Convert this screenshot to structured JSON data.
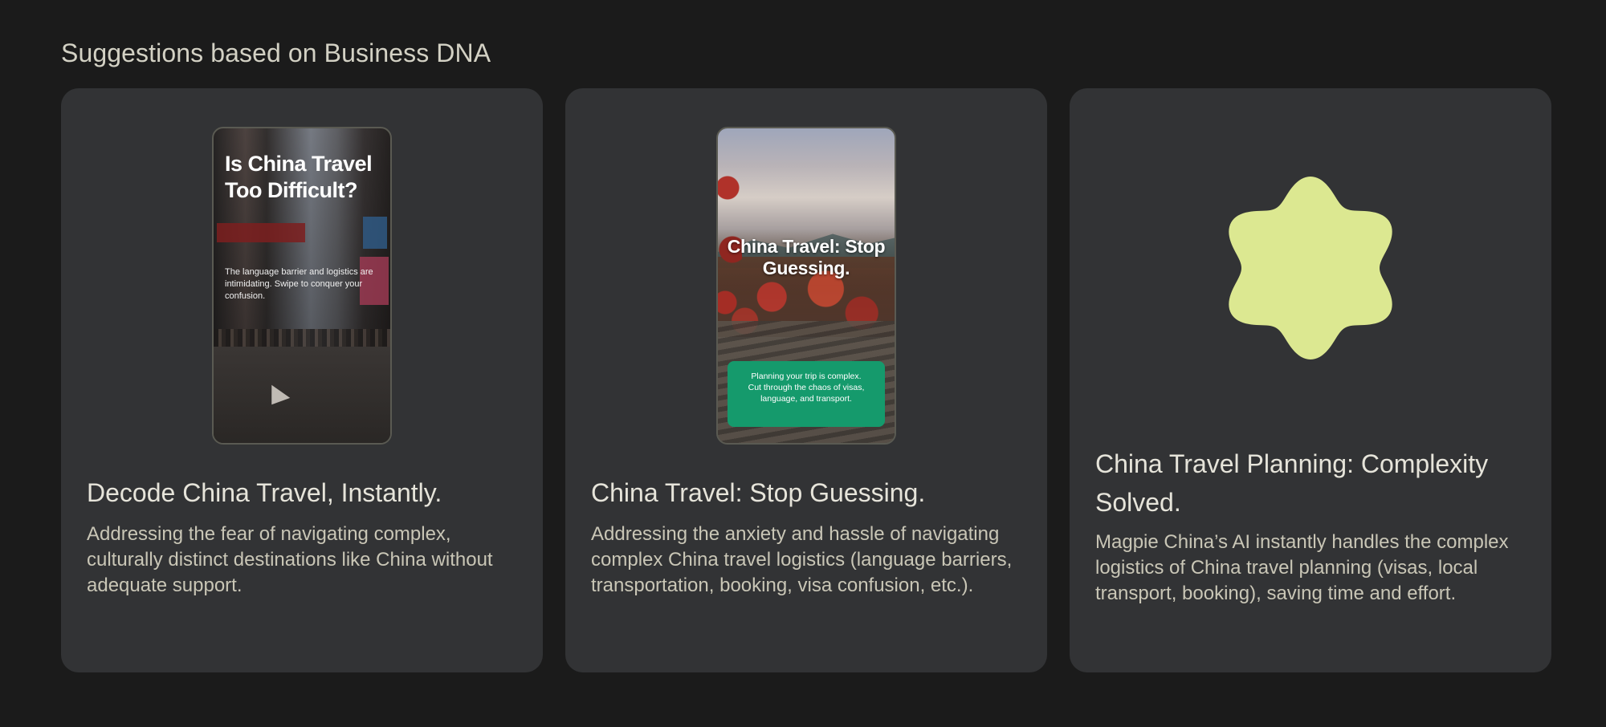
{
  "header": {
    "title": "Suggestions based on Business DNA"
  },
  "cards": [
    {
      "thumbnail": {
        "headline": "Is China Travel Too Difficult?",
        "subtext": "The language barrier and logistics are intimidating. Swipe to conquer your confusion."
      },
      "title": "Decode China Travel, Instantly.",
      "description": "Addressing the fear of navigating complex, culturally distinct destinations like China without adequate support."
    },
    {
      "thumbnail": {
        "headline": "China Travel: Stop Guessing.",
        "box_text": "Planning your trip is complex. Cut through the chaos of visas, language, and transport."
      },
      "title": "China Travel: Stop Guessing.",
      "description": "Addressing the anxiety and hassle of navigating complex China travel logistics (language barriers, transportation, booking, visa confusion, etc.)."
    },
    {
      "graphic": {
        "shape": "scalloped-blob",
        "color": "#dce891"
      },
      "title": "China Travel Planning: Complexity Solved.",
      "description": "Magpie China’s AI instantly handles the complex logistics of China travel planning (visas, local transport, booking), saving time and effort."
    }
  ],
  "colors": {
    "background": "#1b1b1b",
    "card": "#323335",
    "accent_green": "#159a6c",
    "blob": "#dce891"
  }
}
